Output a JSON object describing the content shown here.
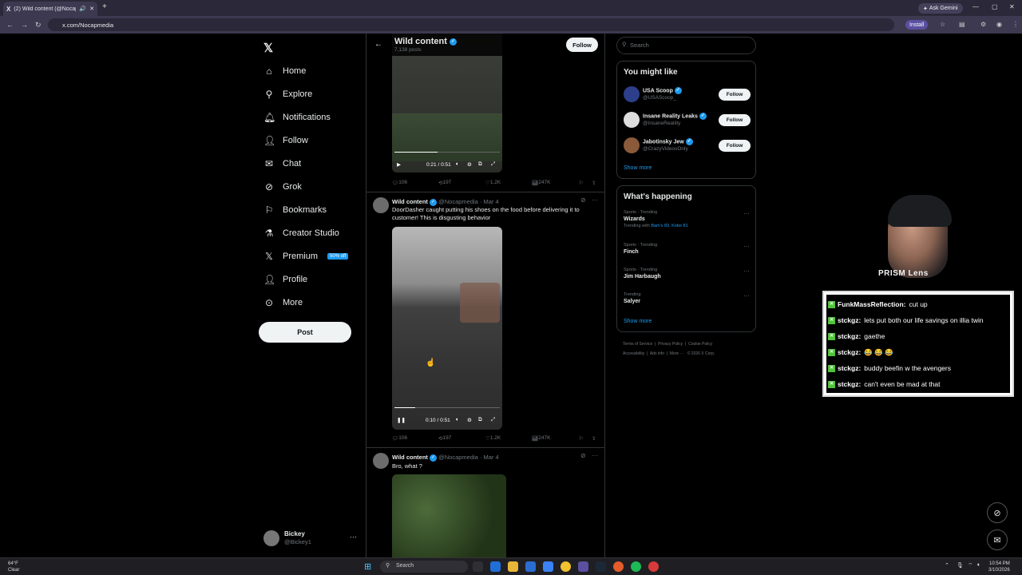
{
  "browser": {
    "tab_title": "(2) Wild content (@Nocapmedia...",
    "url": "x.com/Nocapmedia",
    "ask_gemini": "Ask Gemini",
    "install": "Install"
  },
  "sidebar": {
    "items": [
      {
        "label": "Home",
        "icon": "home-icon"
      },
      {
        "label": "Explore",
        "icon": "search-icon"
      },
      {
        "label": "Notifications",
        "icon": "bell-icon"
      },
      {
        "label": "Follow",
        "icon": "person-add-icon"
      },
      {
        "label": "Chat",
        "icon": "mail-icon"
      },
      {
        "label": "Grok",
        "icon": "grok-icon"
      },
      {
        "label": "Bookmarks",
        "icon": "bookmark-icon"
      },
      {
        "label": "Creator Studio",
        "icon": "flask-icon"
      },
      {
        "label": "Premium",
        "icon": "x-icon"
      },
      {
        "label": "Profile",
        "icon": "person-icon"
      },
      {
        "label": "More",
        "icon": "more-circle-icon"
      }
    ],
    "premium_badge": "50% off",
    "post_label": "Post",
    "user_name": "Bickey",
    "user_handle": "@Bickey1"
  },
  "feed": {
    "title": "Wild content",
    "posts_count": "7,138 posts",
    "follow_label": "Follow",
    "tweets": [
      {
        "video_time": "0:21 / 0:51",
        "video_progress": 0.41,
        "replies": "106",
        "reposts": "197",
        "likes": "1.2K",
        "views": "247K"
      },
      {
        "name": "Wild content",
        "handle": "@Nocapmedia",
        "date": "Mar 4",
        "text": "DoorDasher caught putting his shoes on the food before delivering it to customer! This is disgusting behavior",
        "video_time": "0:10 / 0:51",
        "video_progress": 0.2,
        "replies": "106",
        "reposts": "197",
        "likes": "1.2K",
        "views": "247K"
      },
      {
        "name": "Wild content",
        "handle": "@Nocapmedia",
        "date": "Mar 4",
        "text": "Bro, what ?"
      }
    ]
  },
  "right": {
    "search_placeholder": "Search",
    "you_might_like": "You might like",
    "recommendations": [
      {
        "name": "USA Scoop",
        "handle": "@USAScoop_",
        "button": "Follow"
      },
      {
        "name": "Insane Reality Leaks",
        "handle": "@InsaneRealiity",
        "button": "Follow"
      },
      {
        "name": "Jabotinsky Jew",
        "handle": "@CrazyVideosOnly",
        "button": "Follow"
      }
    ],
    "show_more": "Show more",
    "whats_happening": "What's happening",
    "trends": [
      {
        "category": "Sports · Trending",
        "name": "Wizards",
        "extra_prefix": "Trending with",
        "extra_link": "Bam's 83, Kobe 81"
      },
      {
        "category": "Sports · Trending",
        "name": "Finch"
      },
      {
        "category": "Sports · Trending",
        "name": "Jim Harbaugh"
      },
      {
        "category": "Trending",
        "name": "Salyer"
      }
    ],
    "show_more_2": "Show more",
    "footer": [
      "Terms of Service",
      "Privacy Policy",
      "Cookie Policy",
      "Accessibility",
      "Ads info",
      "More ···",
      "© 2026 X Corp."
    ]
  },
  "overlay": {
    "webcam_label": "PRISM Lens",
    "chat": [
      {
        "user": "FunkMassReflection:",
        "text": "cut up"
      },
      {
        "user": "stckgz:",
        "text": "lets put both our life savings on illia twin"
      },
      {
        "user": "stckgz:",
        "text": "gaethe"
      },
      {
        "user": "stckgz:",
        "text": "😂 😂 😂"
      },
      {
        "user": "stckgz:",
        "text": "buddy beefin w the avengers"
      },
      {
        "user": "stckgz:",
        "text": "can't even be mad at that"
      }
    ]
  },
  "taskbar": {
    "temp": "64°F",
    "weather": "Clear",
    "search_label": "Search",
    "time": "10:54 PM",
    "date": "3/10/2026"
  }
}
